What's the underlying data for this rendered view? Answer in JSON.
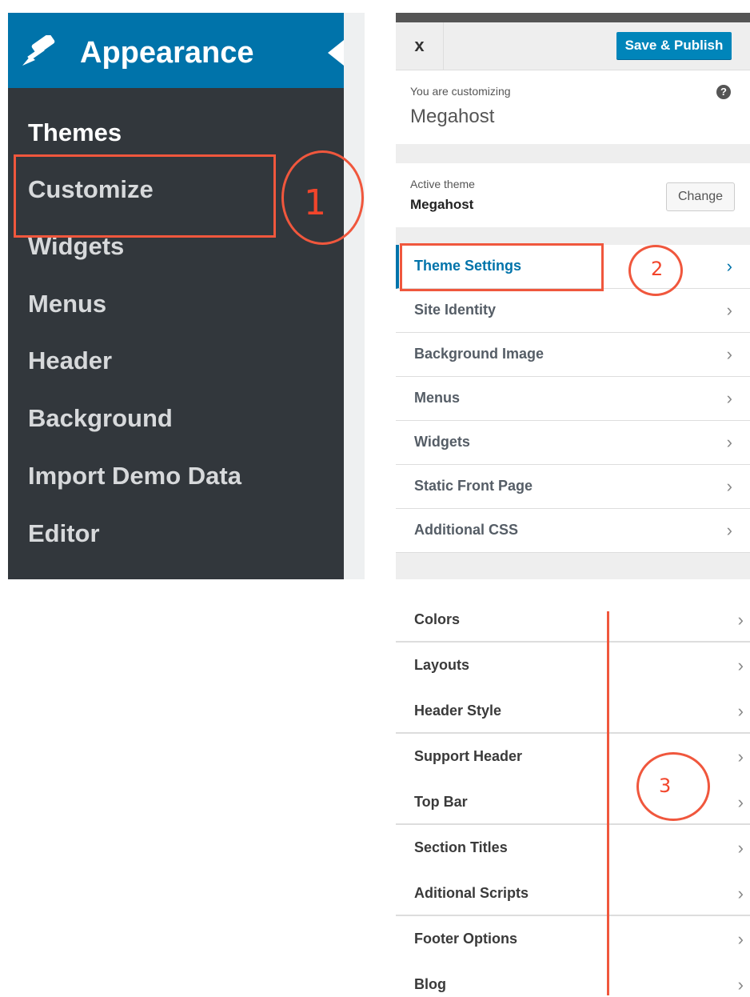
{
  "admin_menu": {
    "title": "Appearance",
    "items": [
      {
        "label": "Themes",
        "current": true
      },
      {
        "label": "Customize"
      },
      {
        "label": "Widgets"
      },
      {
        "label": "Menus"
      },
      {
        "label": "Header"
      },
      {
        "label": "Background"
      },
      {
        "label": "Import Demo Data"
      },
      {
        "label": "Editor"
      }
    ]
  },
  "customizer": {
    "close_label": "x",
    "save_label": "Save & Publish",
    "customizing_label": "You are customizing",
    "site_name": "Megahost",
    "help_label": "?",
    "active_theme_label": "Active theme",
    "active_theme_name": "Megahost",
    "change_label": "Change",
    "sections": [
      {
        "label": "Theme Settings",
        "active": true
      },
      {
        "label": "Site Identity"
      },
      {
        "label": "Background Image"
      },
      {
        "label": "Menus"
      },
      {
        "label": "Widgets"
      },
      {
        "label": "Static Front Page"
      },
      {
        "label": "Additional CSS"
      }
    ]
  },
  "theme_settings": {
    "items": [
      {
        "label": "Colors"
      },
      {
        "label": "Layouts"
      },
      {
        "label": "Header Style"
      },
      {
        "label": "Support Header"
      },
      {
        "label": "Top Bar"
      },
      {
        "label": "Section Titles"
      },
      {
        "label": "Aditional Scripts"
      },
      {
        "label": "Footer Options"
      },
      {
        "label": "Blog"
      }
    ]
  },
  "annotations": {
    "step1": "1",
    "step2": "2",
    "step3": "3"
  },
  "icons": {
    "chevron": "›",
    "menu_icon": "brush-icon"
  },
  "colors": {
    "admin_bg": "#32373c",
    "admin_accent": "#0073aa",
    "annotation": "#f0573d",
    "publish_button": "#0085ba"
  }
}
